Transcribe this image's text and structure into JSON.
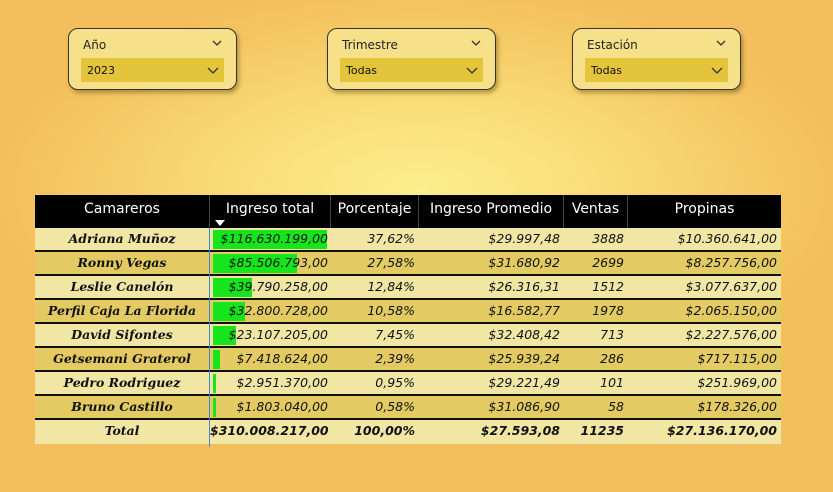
{
  "slicers": [
    {
      "label": "Año",
      "value": "2023"
    },
    {
      "label": "Trimestre",
      "value": "Todas"
    },
    {
      "label": "Estación",
      "value": "Todas"
    }
  ],
  "table": {
    "headers": [
      "Camareros",
      "Ingreso total",
      "Porcentaje",
      "Ingreso Promedio",
      "Ventas",
      "Propinas"
    ],
    "rows": [
      {
        "name": "Adriana Muñoz",
        "ingreso": "$116.630.199,00",
        "share": 1.0,
        "pct": "37,62%",
        "promedio": "$29.997,48",
        "ventas": "3888",
        "propinas": "$10.360.641,00"
      },
      {
        "name": "Ronny Vegas",
        "ingreso": "$85.506.793,00",
        "share": 0.733,
        "pct": "27,58%",
        "promedio": "$31.680,92",
        "ventas": "2699",
        "propinas": "$8.257.756,00"
      },
      {
        "name": "Leslie Canelón",
        "ingreso": "$39.790.258,00",
        "share": 0.341,
        "pct": "12,84%",
        "promedio": "$26.316,31",
        "ventas": "1512",
        "propinas": "$3.077.637,00"
      },
      {
        "name": "Perfil Caja La Florida",
        "ingreso": "$32.800.728,00",
        "share": 0.281,
        "pct": "10,58%",
        "promedio": "$16.582,77",
        "ventas": "1978",
        "propinas": "$2.065.150,00"
      },
      {
        "name": "David Sifontes",
        "ingreso": "$23.107.205,00",
        "share": 0.198,
        "pct": "7,45%",
        "promedio": "$32.408,42",
        "ventas": "713",
        "propinas": "$2.227.576,00"
      },
      {
        "name": "Getsemani Graterol",
        "ingreso": "$7.418.624,00",
        "share": 0.064,
        "pct": "2,39%",
        "promedio": "$25.939,24",
        "ventas": "286",
        "propinas": "$717.115,00"
      },
      {
        "name": "Pedro Rodriguez",
        "ingreso": "$2.951.370,00",
        "share": 0.025,
        "pct": "0,95%",
        "promedio": "$29.221,49",
        "ventas": "101",
        "propinas": "$251.969,00"
      },
      {
        "name": "Bruno Castillo",
        "ingreso": "$1.803.040,00",
        "share": 0.015,
        "pct": "0,58%",
        "promedio": "$31.086,90",
        "ventas": "58",
        "propinas": "$178.326,00"
      }
    ],
    "total": {
      "name": "Total",
      "ingreso": "$310.008.217,00",
      "pct": "100,00%",
      "promedio": "$27.593,08",
      "ventas": "11235",
      "propinas": "$27.136.170,00"
    }
  },
  "colors": {
    "bar": "#15e61b",
    "header_bg": "#000000",
    "row_light": "#f2e6a4",
    "row_dark": "#e3ca62",
    "slicer_select": "#e3c43a"
  },
  "icons": {
    "slicer_toggle": "chevron-down-icon",
    "dropdown": "chevron-down-icon",
    "sort": "sort-descending-icon"
  }
}
